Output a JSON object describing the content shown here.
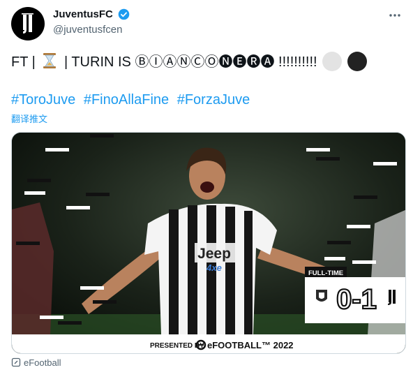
{
  "account": {
    "display_name": "JuventusFC",
    "handle": "@juventusfcen",
    "avatar_icon": "juventus-logo-icon",
    "verified_icon": "verified-badge-icon",
    "verified_color": "#1d9bf0"
  },
  "tweet": {
    "prefix": "FT | ",
    "emoji_icon": "hourglass-icon",
    "middle": " | TURIN IS ",
    "circled_text": "ⒷⒾⒶⓃⒸⓄ",
    "negative_circled_text": "🅝🅔🅡🅐",
    "suffix": " !!!!!!!!!! ",
    "dot_colors": [
      "#e3e3e3",
      "#222222"
    ]
  },
  "hashtags": [
    "#ToroJuve",
    "#FinoAllaFine",
    "#ForzaJuve"
  ],
  "translate_label": "翻译推文",
  "media": {
    "jersey_brand": "Jeep",
    "jersey_sub": "4xe",
    "fulltime_label": "FULL-TIME",
    "score": "0-1",
    "presented_by": "PRESENTED BY",
    "sponsor": "eFOOTBALL™ 2022"
  },
  "footer": {
    "icon": "link-card-icon",
    "label": "eFootball"
  }
}
